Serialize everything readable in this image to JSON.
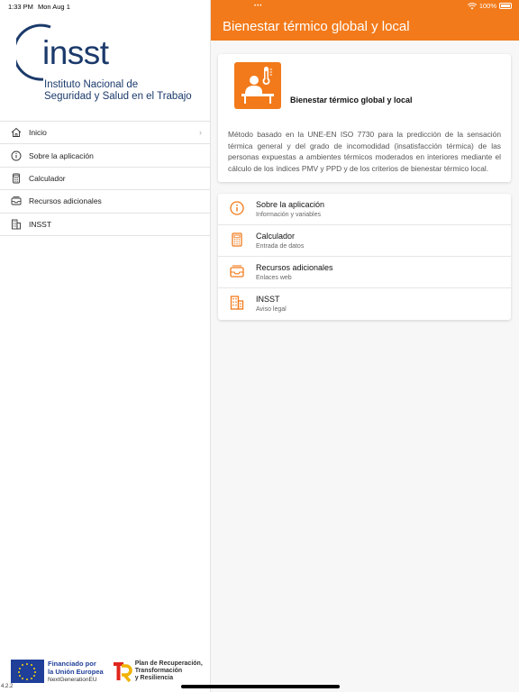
{
  "status_bar": {
    "time": "1:33 PM",
    "date": "Mon Aug 1",
    "battery": "100%"
  },
  "sidebar": {
    "logo_brand": "insst",
    "logo_subtitle_line1": "Instituto Nacional de",
    "logo_subtitle_line2": "Seguridad y Salud en el Trabajo",
    "items": [
      {
        "label": "Inicio",
        "icon": "home-icon"
      },
      {
        "label": "Sobre la aplicación",
        "icon": "info-icon"
      },
      {
        "label": "Calculador",
        "icon": "calculator-icon"
      },
      {
        "label": "Recursos adicionales",
        "icon": "inbox-icon"
      },
      {
        "label": "INSST",
        "icon": "building-icon"
      }
    ],
    "footer": {
      "eu_line1": "Financiado por",
      "eu_line2": "la Unión Europea",
      "eu_line3": "NextGenerationEU",
      "prtr_line1": "Plan de Recuperación,",
      "prtr_line2": "Transformación",
      "prtr_line3": "y Resiliencia"
    },
    "version": "4.2.2"
  },
  "header": {
    "title": "Bienestar térmico global y local"
  },
  "card": {
    "title": "Bienestar térmico global y local",
    "description": "Método basado en la UNE-EN ISO 7730 para la predicción de la sensación térmica general y del grado de incomodidad (insatisfacción térmica) de las personas expuestas a ambientes térmicos moderados en interiores mediante el cálculo de los índices PMV y PPD y de los criterios de bienestar térmico local."
  },
  "list": [
    {
      "title": "Sobre la aplicación",
      "subtitle": "Información y variables",
      "icon": "info-icon"
    },
    {
      "title": "Calculador",
      "subtitle": "Entrada de datos",
      "icon": "calculator-icon"
    },
    {
      "title": "Recursos adicionales",
      "subtitle": "Enlaces web",
      "icon": "inbox-icon"
    },
    {
      "title": "INSST",
      "subtitle": "Aviso legal",
      "icon": "building-icon"
    }
  ],
  "colors": {
    "accent": "#f27a1a",
    "brand_navy": "#1b3a6b"
  }
}
